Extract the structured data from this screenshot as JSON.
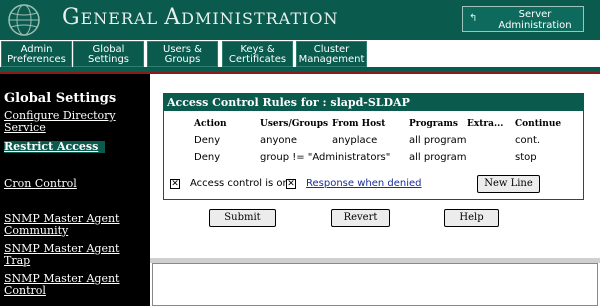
{
  "header": {
    "title": "General Administration",
    "title_parts": [
      "G",
      "ENERAL ",
      "A",
      "DMINISTRATION"
    ],
    "server_button": [
      "Server",
      "Administration"
    ],
    "colors": {
      "bar": "#0b5a4e",
      "accent_red": "#8b1a1a"
    }
  },
  "tabs": [
    {
      "lines": [
        "Admin",
        "Preferences"
      ]
    },
    {
      "lines": [
        "Global",
        "Settings"
      ],
      "active": true
    },
    {
      "lines": [
        "Users &",
        "Groups"
      ]
    },
    {
      "lines": [
        "Keys &",
        "Certificates"
      ]
    },
    {
      "lines": [
        "Cluster",
        "Management"
      ]
    }
  ],
  "sidebar": {
    "title": "Global Settings",
    "items": [
      {
        "lines": [
          "Configure Directory",
          "Service"
        ]
      },
      {
        "lines": [
          "Restrict Access"
        ],
        "active": true
      },
      {
        "lines": [
          "Cron Control"
        ]
      },
      {
        "lines": [
          "SNMP Master Agent",
          "Community"
        ]
      },
      {
        "lines": [
          "SNMP Master Agent",
          "Trap"
        ]
      },
      {
        "lines": [
          "SNMP Master Agent",
          "Control"
        ]
      }
    ]
  },
  "panel": {
    "title": "Access Control Rules for : slapd-SLDAP",
    "columns": [
      "Action",
      "Users/Groups",
      "From Host",
      "Programs",
      "Extra...",
      "Continue"
    ],
    "rows": [
      [
        "Deny",
        "anyone",
        "anyplace",
        "all program",
        "",
        "cont."
      ],
      [
        "Deny",
        "group != \"Administrators\"",
        "",
        "all program",
        "",
        "stop"
      ]
    ],
    "access_on_label": "Access control is on",
    "response_link": "Response when denied",
    "new_line": "New Line",
    "checkbox_mark": "✕"
  },
  "actions": {
    "submit": "Submit",
    "revert": "Revert",
    "help": "Help"
  }
}
